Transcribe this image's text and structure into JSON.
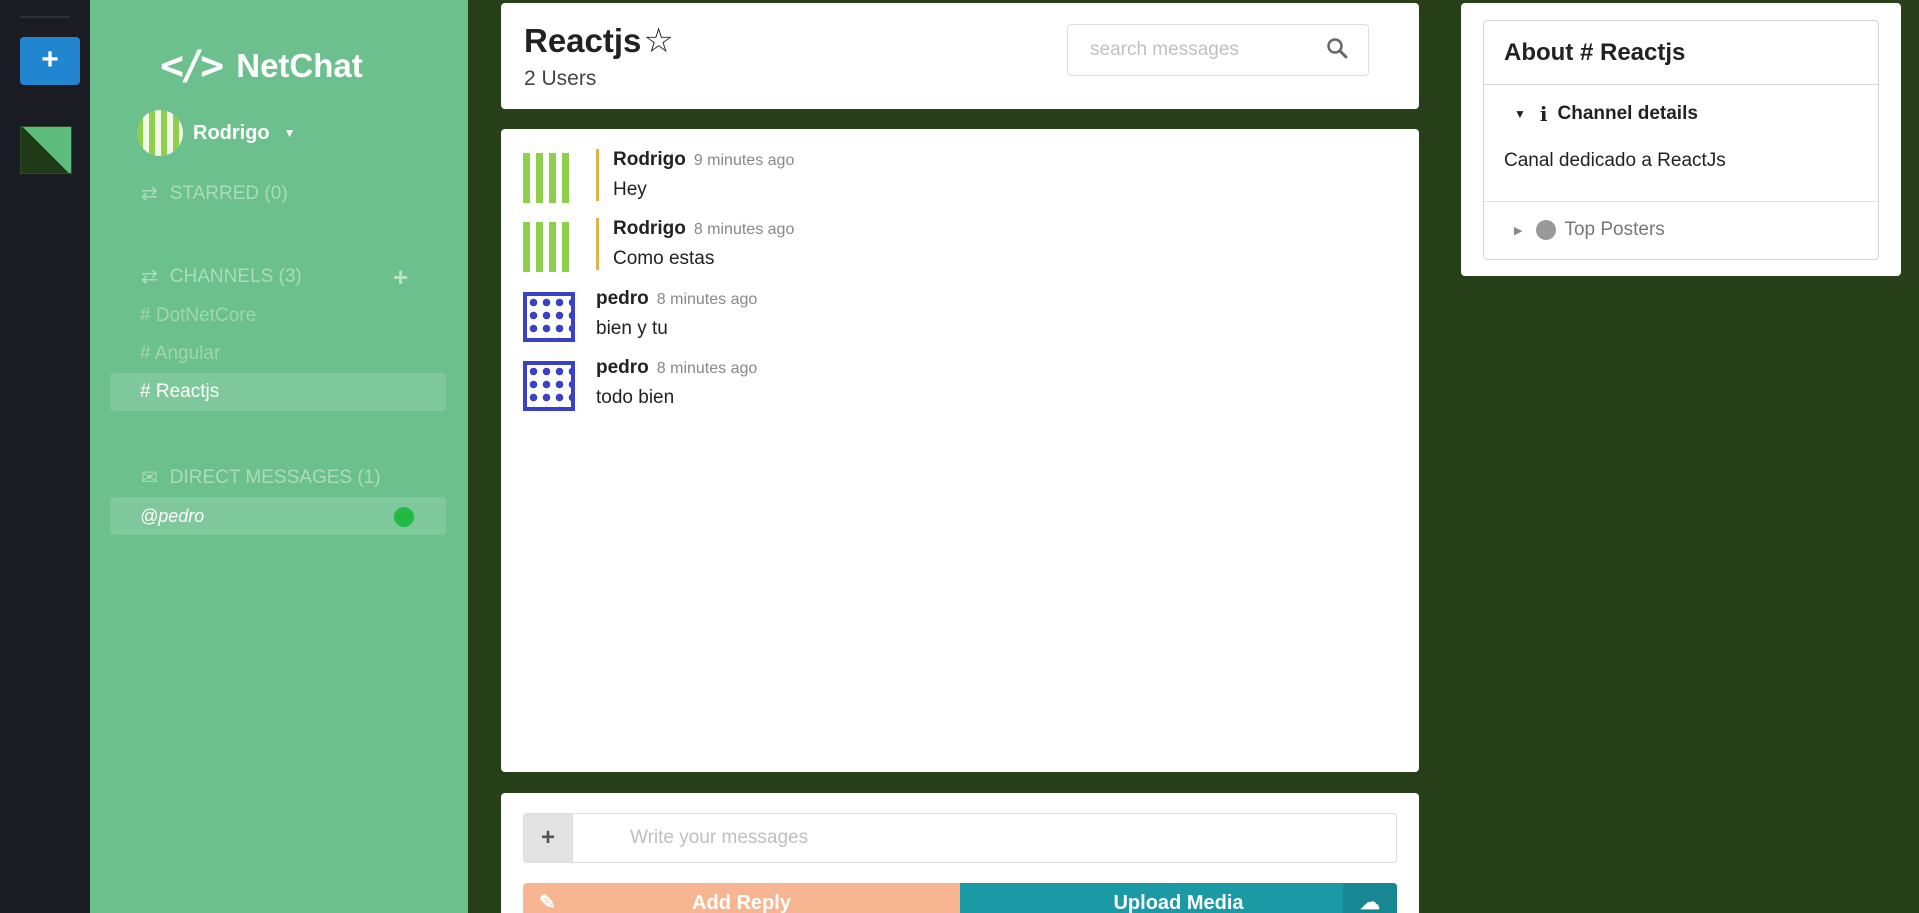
{
  "app": {
    "brand": "NetChat",
    "brand_icon": "code-icon"
  },
  "rail": {
    "add_label": "+"
  },
  "user": {
    "name": "Rodrigo"
  },
  "sidebar": {
    "starred_label": "STARRED (0)",
    "channels_label": "CHANNELS (3)",
    "channels": [
      {
        "label": "# DotNetCore",
        "active": false
      },
      {
        "label": "# Angular",
        "active": false
      },
      {
        "label": "# Reactjs",
        "active": true
      }
    ],
    "dm_label": "DIRECT MESSAGES (1)",
    "direct_messages": [
      {
        "label": "@pedro",
        "online": true
      }
    ]
  },
  "header": {
    "title": "Reactjs",
    "users": "2 Users",
    "search_placeholder": "search messages"
  },
  "messages": [
    {
      "author": "Rodrigo",
      "time": "9 minutes ago",
      "text": "Hey",
      "own": true
    },
    {
      "author": "Rodrigo",
      "time": "8 minutes ago",
      "text": "Como estas",
      "own": true
    },
    {
      "author": "pedro",
      "time": "8 minutes ago",
      "text": "bien y tu",
      "own": false
    },
    {
      "author": "pedro",
      "time": "8 minutes ago",
      "text": "todo bien",
      "own": false
    }
  ],
  "form": {
    "placeholder": "Write your messages",
    "reply_label": "Add Reply",
    "upload_label": "Upload Media"
  },
  "meta": {
    "title": "About # Reactjs",
    "details_title": "Channel details",
    "details_text": "Canal dedicado a ReactJs",
    "top_posters_title": "Top Posters"
  },
  "colors": {
    "sidebar": "#6cc08d",
    "background": "#27401a",
    "rail": "#1b1b24",
    "accent": "#2185d0",
    "upload": "#1b9aa6",
    "reply": "#f7b591",
    "online": "#21ba45"
  }
}
